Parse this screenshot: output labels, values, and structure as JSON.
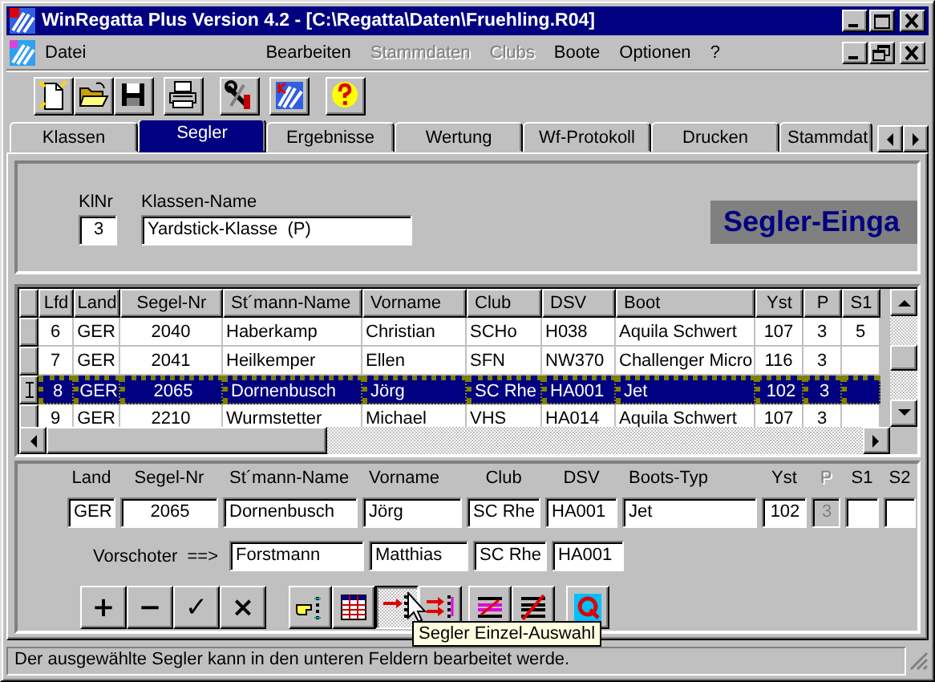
{
  "window": {
    "title": "WinRegatta Plus Version 4.2 - [C:\\Regatta\\Daten\\Fruehling.R04]"
  },
  "menu": [
    {
      "label": "Datei",
      "disabled": false
    },
    {
      "label": "Bearbeiten",
      "disabled": false
    },
    {
      "label": "Stammdaten",
      "disabled": true
    },
    {
      "label": "Clubs",
      "disabled": true
    },
    {
      "label": "Boote",
      "disabled": false
    },
    {
      "label": "Optionen",
      "disabled": false
    },
    {
      "label": "?",
      "disabled": false
    }
  ],
  "tabs": [
    {
      "label": "Klassen",
      "selected": false
    },
    {
      "label": "Segler",
      "selected": true
    },
    {
      "label": "Ergebnisse",
      "selected": false
    },
    {
      "label": "Wertung",
      "selected": false
    },
    {
      "label": "Wf-Protokoll",
      "selected": false
    },
    {
      "label": "Drucken",
      "selected": false
    },
    {
      "label": "Stammdat",
      "selected": false
    }
  ],
  "class_header": {
    "klnr_label": "KlNr",
    "klnr": "3",
    "name_label": "Klassen-Name",
    "name": "Yardstick-Klasse  (P)",
    "banner": "Segler-Einga"
  },
  "grid": {
    "columns": [
      "Lfd",
      "Land",
      "Segel-Nr",
      "St´mann-Name",
      "Vorname",
      "Club",
      "DSV",
      "Boot",
      "Yst",
      "P",
      "S1"
    ],
    "rows": [
      {
        "selected": false,
        "cells": [
          "6",
          "GER",
          "2040",
          "Haberkamp",
          "Christian",
          "SCHo",
          "H038",
          "Aquila Schwert",
          "107",
          "3",
          "5"
        ]
      },
      {
        "selected": false,
        "cells": [
          "7",
          "GER",
          "2041",
          "Heilkemper",
          "Ellen",
          "SFN",
          "NW370",
          "Challenger Micro",
          "116",
          "3",
          ""
        ]
      },
      {
        "selected": true,
        "cells": [
          "8",
          "GER",
          "2065",
          "Dornenbusch",
          "Jörg",
          "SC Rhe",
          "HA001",
          "Jet",
          "102",
          "3",
          ""
        ]
      },
      {
        "selected": false,
        "cells": [
          "9",
          "GER",
          "2210",
          "Wurmstetter",
          "Michael",
          "VHS",
          "HA014",
          "Aquila Schwert",
          "107",
          "3",
          ""
        ]
      }
    ]
  },
  "editor": {
    "fields": [
      {
        "label": "Land",
        "value": "GER",
        "disabled": false
      },
      {
        "label": "Segel-Nr",
        "value": "2065",
        "disabled": false
      },
      {
        "label": "St´mann-Name",
        "value": "Dornenbusch",
        "disabled": false
      },
      {
        "label": "Vorname",
        "value": "Jörg",
        "disabled": false
      },
      {
        "label": "Club",
        "value": "SC Rhe",
        "disabled": false
      },
      {
        "label": "DSV",
        "value": "HA001",
        "disabled": false
      },
      {
        "label": "Boots-Typ",
        "value": "Jet",
        "disabled": false
      },
      {
        "label": "Yst",
        "value": "102",
        "disabled": false
      },
      {
        "label": "P",
        "value": "3",
        "disabled": true
      },
      {
        "label": "S1",
        "disabled": false
      },
      {
        "label": "S2",
        "disabled": false
      }
    ],
    "vorschoter_label": "Vorschoter  ==>",
    "vorschoter": [
      "Forstmann",
      "Matthias",
      "SC Rhe",
      "HA001"
    ]
  },
  "action_buttons": [
    "+",
    "−",
    "✓",
    "×"
  ],
  "tool_buttons": [
    {
      "pressed": false
    },
    {
      "pressed": false
    },
    {
      "pressed": true
    },
    {
      "pressed": false
    },
    {
      "pressed": false
    },
    {
      "pressed": false
    },
    {
      "pressed": false
    }
  ],
  "tooltip": "Segler Einzel-Auswahl",
  "status_bar": "Der ausgewählte Segler kann in den unteren Feldern bearbeitet werde."
}
